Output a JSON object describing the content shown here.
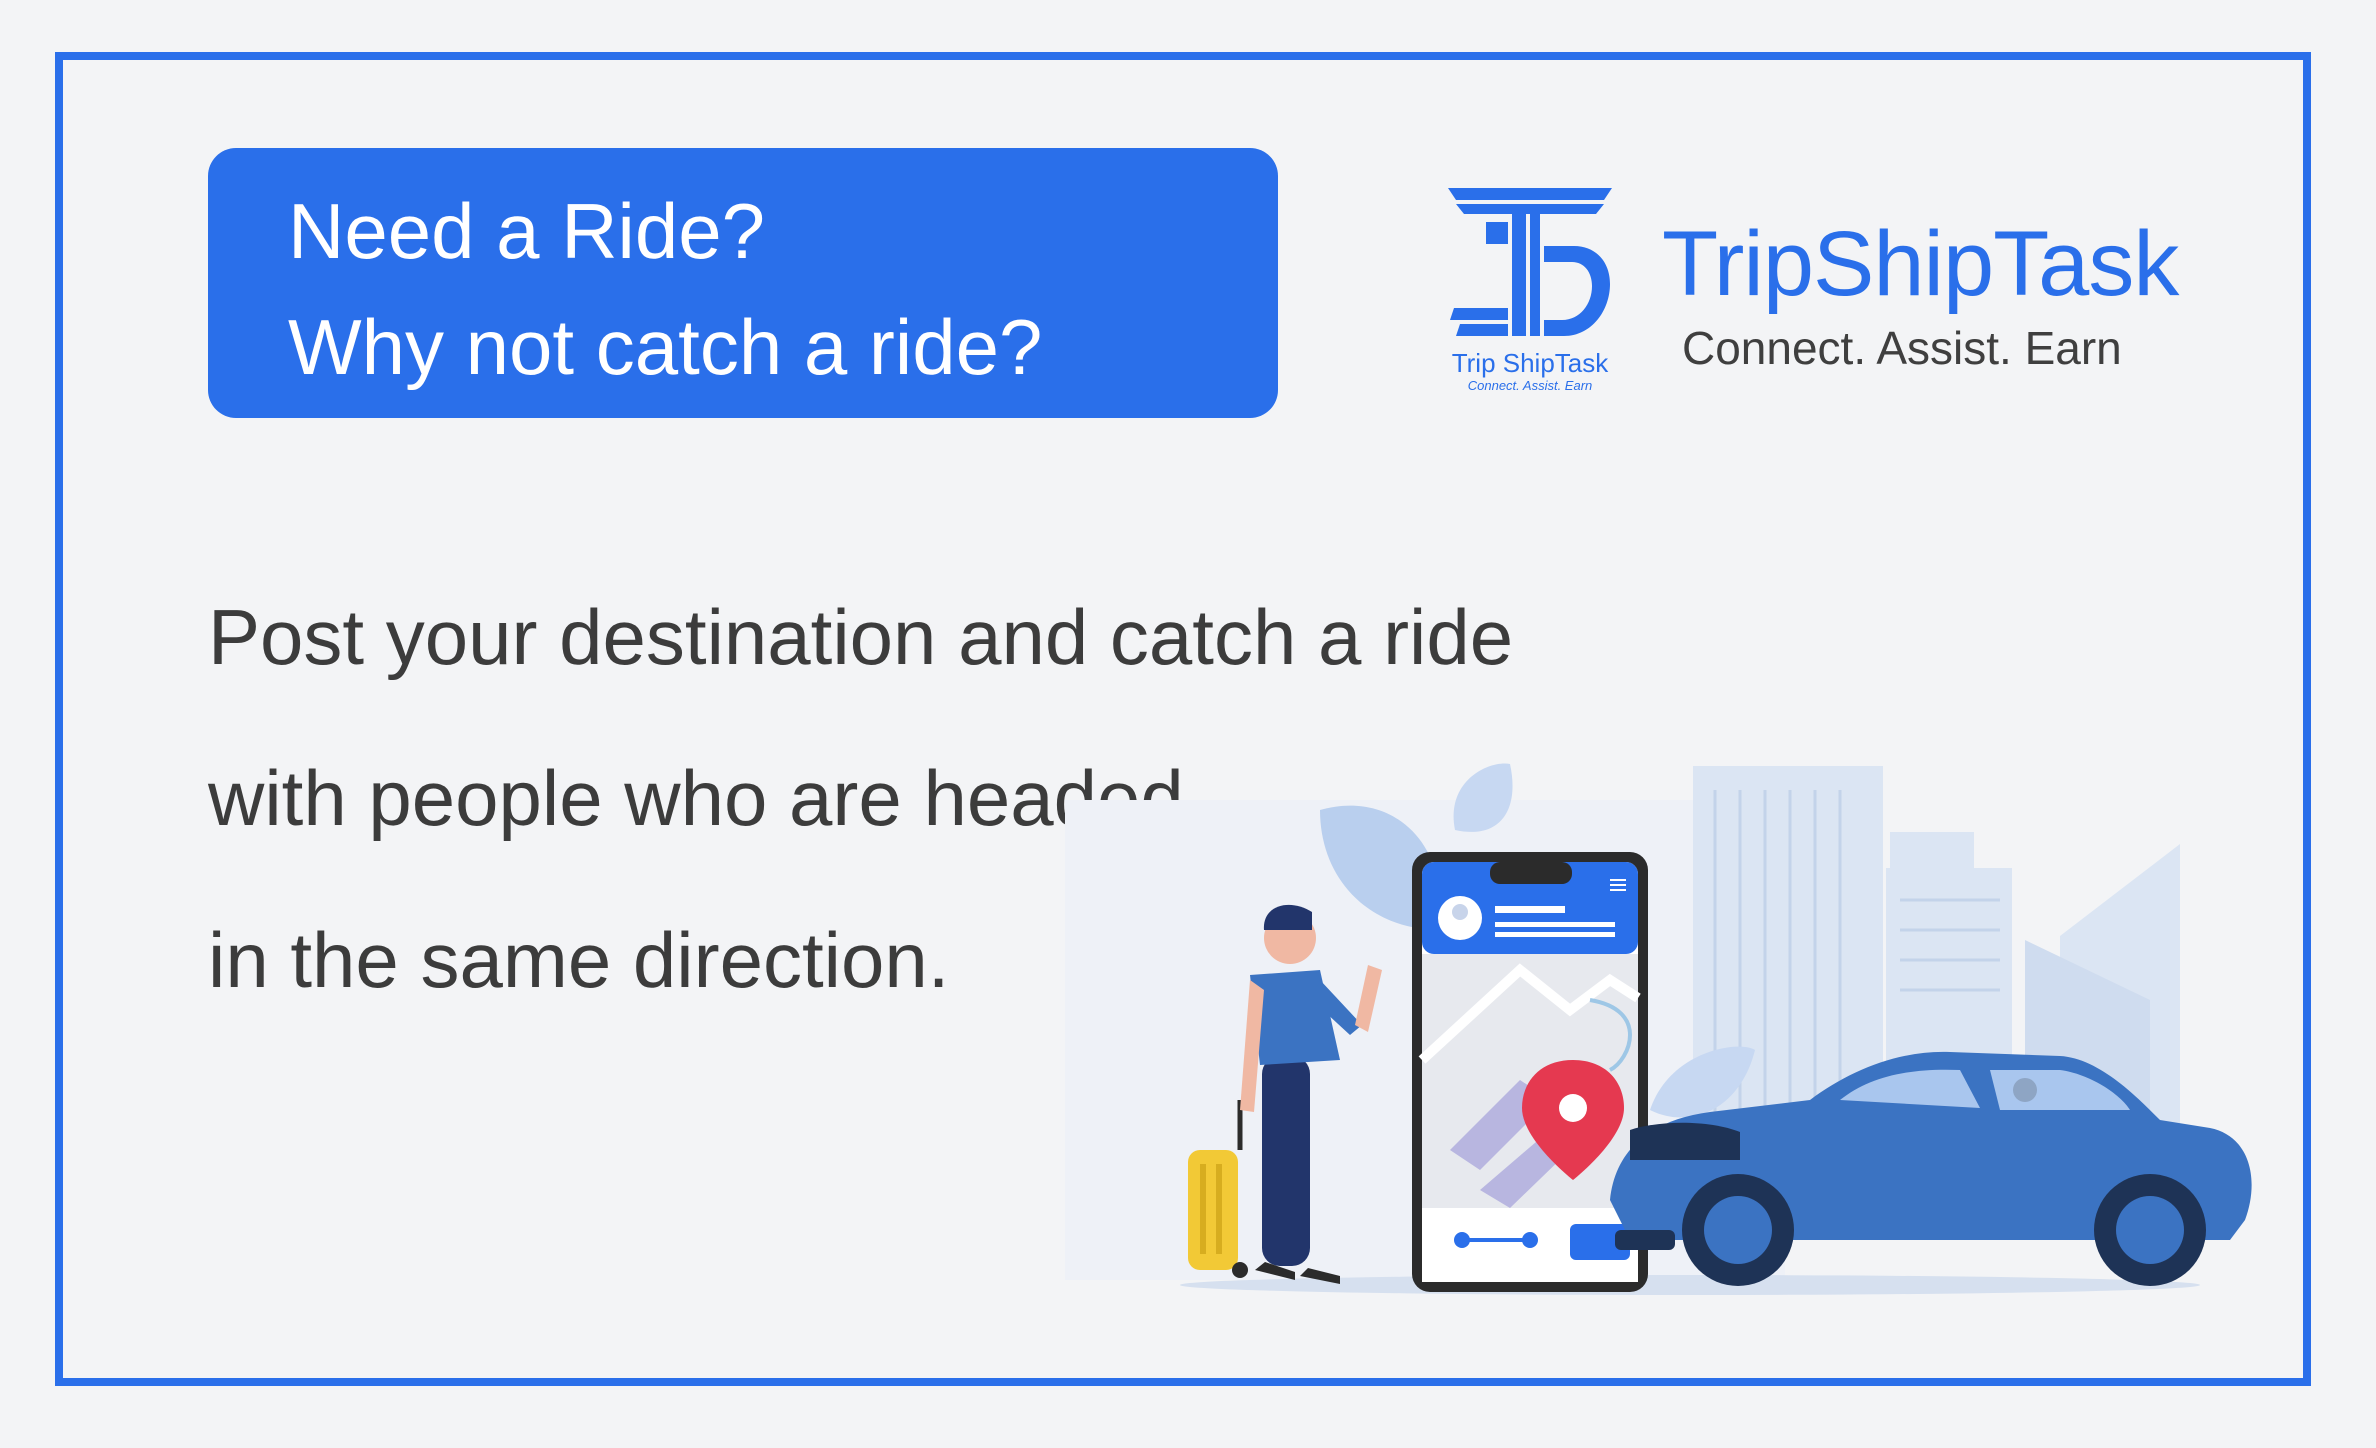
{
  "headline": {
    "line1": "Need a Ride?",
    "line2": "Why not catch a ride?"
  },
  "brand": {
    "name": "TripShipTask",
    "tagline": "Connect. Assist. Earn",
    "emblem_name": "Trip ShipTask",
    "emblem_tagline": "Connect. Assist. Earn"
  },
  "body": {
    "line1": "Post your destination and catch a ride",
    "line2": "with people who are headed",
    "line3": "in the same direction."
  },
  "colors": {
    "accent": "#2a6fea",
    "text": "#3c3c3c",
    "background": "#f3f4f6",
    "car": "#3b73c2",
    "pin": "#e53950"
  },
  "illustration": {
    "icons": [
      "person-with-suitcase",
      "smartphone-map",
      "location-pin-icon",
      "car",
      "city-buildings",
      "leaves"
    ]
  }
}
